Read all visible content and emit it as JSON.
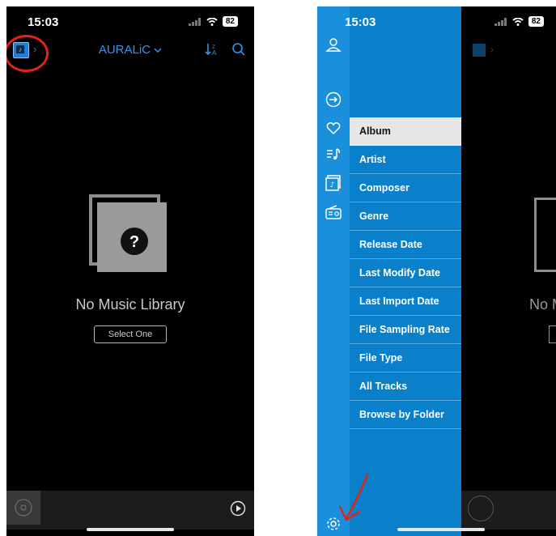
{
  "left_screen": {
    "status": {
      "time": "15:03",
      "battery": "82"
    },
    "nav": {
      "title": "AURALiC"
    },
    "empty_state": {
      "icon": "question-mark-icon",
      "message": "No Music Library",
      "button_label": "Select One"
    },
    "player": {
      "play_icon": "play-icon"
    }
  },
  "right_screen": {
    "status": {
      "time": "15:03",
      "battery": "82"
    },
    "rail_icons": [
      "profile-icon",
      "arrow-right-circle-icon",
      "heart-icon",
      "playlist-icon",
      "library-icon",
      "radio-icon",
      "gear-icon"
    ],
    "menu": {
      "items": [
        "Album",
        "Artist",
        "Composer",
        "Genre",
        "Release Date",
        "Last Modify Date",
        "Last Import Date",
        "File Sampling Rate",
        "File Type",
        "All Tracks",
        "Browse by Folder"
      ],
      "selected": "Album"
    }
  },
  "colors": {
    "accent": "#1e7fd6",
    "menu_blue": "#0a7fca",
    "rail_blue": "#1a8fdc",
    "annotation_red": "#e0241b"
  }
}
